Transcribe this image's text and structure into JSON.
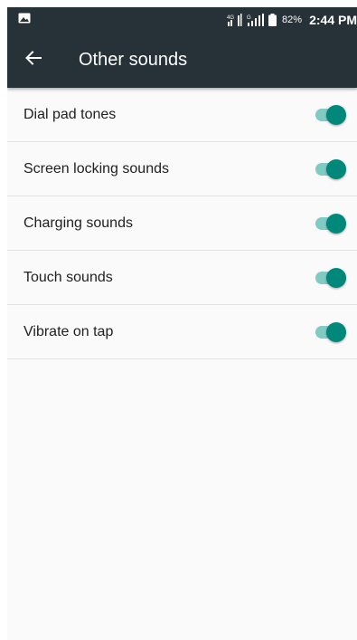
{
  "status_bar": {
    "network_4g": "4G",
    "network_g": "G",
    "battery_percent": "82%",
    "time": "2:44 PM",
    "icons": [
      "image-notification-icon",
      "signal-icon",
      "signal-icon",
      "battery-icon"
    ]
  },
  "app_bar": {
    "title": "Other sounds",
    "back_icon": "arrow-back-icon"
  },
  "settings": {
    "items": [
      {
        "label": "Dial pad tones",
        "enabled": true
      },
      {
        "label": "Screen locking sounds",
        "enabled": true
      },
      {
        "label": "Charging sounds",
        "enabled": true
      },
      {
        "label": "Touch sounds",
        "enabled": true
      },
      {
        "label": "Vibrate on tap",
        "enabled": true
      }
    ]
  },
  "colors": {
    "app_bar": "#263238",
    "switch_thumb_on": "#00897b",
    "switch_track_on": "#80cbc4"
  }
}
